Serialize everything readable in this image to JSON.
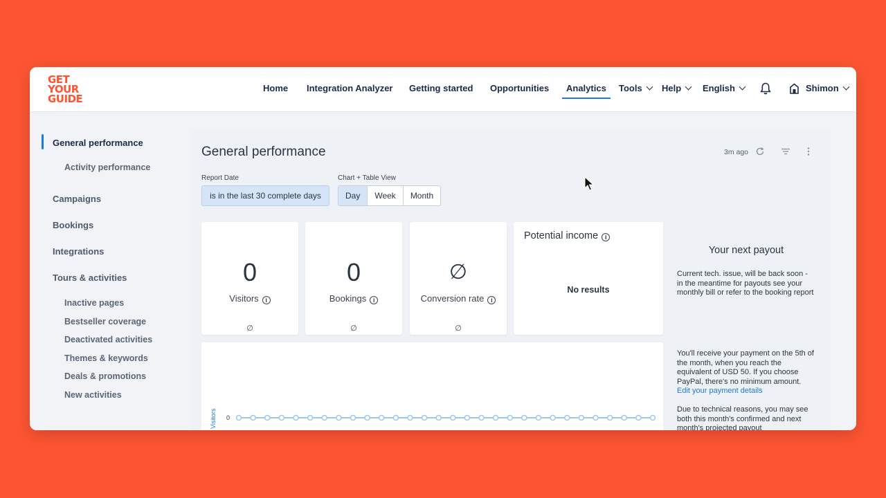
{
  "logo": {
    "lines": [
      "GET",
      "YOUR",
      "GUIDE"
    ]
  },
  "nav": {
    "home": "Home",
    "integration_analyzer": "Integration Analyzer",
    "getting_started": "Getting started",
    "opportunities": "Opportunities",
    "analytics": "Analytics",
    "tools": "Tools",
    "help": "Help",
    "language": "English",
    "user": "Shimon"
  },
  "sidebar": {
    "general_performance": "General performance",
    "activity_performance": "Activity performance",
    "campaigns": "Campaigns",
    "bookings": "Bookings",
    "integrations": "Integrations",
    "tours_activities": "Tours & activities",
    "inactive_pages": "Inactive pages",
    "bestseller_coverage": "Bestseller coverage",
    "deactivated_activities": "Deactivated activities",
    "themes_keywords": "Themes & keywords",
    "deals_promotions": "Deals & promotions",
    "new_activities": "New activities"
  },
  "page": {
    "title": "General performance",
    "last_updated": "3m ago"
  },
  "filters": {
    "report_date_label": "Report Date",
    "report_date_value": "is in the last 30 complete days",
    "view_label": "Chart + Table View",
    "view_options": [
      "Day",
      "Week",
      "Month"
    ],
    "view_selected": "Day"
  },
  "kpis": {
    "visitors": {
      "value": "0",
      "label": "Visitors",
      "foot": "∅"
    },
    "bookings": {
      "value": "0",
      "label": "Bookings",
      "foot": "∅"
    },
    "conversion": {
      "value": "∅",
      "label": "Conversion rate",
      "foot": "∅"
    }
  },
  "potential_income": {
    "title": "Potential income",
    "message": "No results"
  },
  "payout": {
    "title": "Your next payout",
    "p1": "Current tech. issue, will be back soon - in the meantime for payouts see your monthly bill or refer to the booking report",
    "p2": "You'll receive your payment on the 5th of the month, when you reach the equivalent of USD 50. If you choose PayPal, there's no minimum amount.",
    "p2_link": "Edit your payment details",
    "p3": "Due to technical reasons, you may see both this month's confirmed and next month's projected payout"
  },
  "chart_data": {
    "type": "line",
    "ylabel": "Visitors",
    "y_tick": "0",
    "values": [
      0,
      0,
      0,
      0,
      0,
      0,
      0,
      0,
      0,
      0,
      0,
      0,
      0,
      0,
      0,
      0,
      0,
      0,
      0,
      0,
      0,
      0,
      0,
      0,
      0,
      0,
      0,
      0,
      0,
      0
    ],
    "ylim": [
      0,
      1
    ],
    "series_color": "#9cc7ee"
  },
  "colors": {
    "brand": "#fd5533",
    "accent": "#1d7bd6"
  }
}
